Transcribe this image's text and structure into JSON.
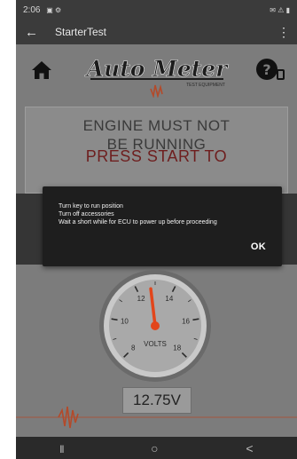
{
  "status_bar": {
    "time": "2:06",
    "left_icons": "▣ ⚙",
    "right_icons": "✉ ⚠ ▮"
  },
  "app_bar": {
    "back_icon": "←",
    "title": "StarterTest",
    "menu_icon": "⋮"
  },
  "brand": {
    "logo_text": "Auto Meter",
    "logo_subtext": "TEST EQUIPMENT"
  },
  "instructions": {
    "warning_line1": "ENGINE MUST NOT",
    "warning_line2": "BE RUNNING",
    "press_start": "PRESS START TO"
  },
  "dialog": {
    "line1": "Turn key to run position",
    "line2": "Turn off accessories",
    "line3": "Wait a short while for ECU to power up before proceeding",
    "ok_label": "OK"
  },
  "gauge": {
    "unit_label": "VOLTS",
    "tick_labels": [
      "8",
      "10",
      "12",
      "14",
      "16",
      "18"
    ],
    "needle_value_volts": 12.75,
    "needle_color": "#e2461b"
  },
  "readout": {
    "value": "12.75V"
  },
  "nav_bar": {
    "recent_icon": "|||",
    "home_icon": "○",
    "back_icon": "<"
  },
  "colors": {
    "app_bg": "#7c7c7c",
    "status_bar": "#3b3b3b",
    "dialog_bg": "#1e1e1e",
    "logo_dark": "#1d1d1d",
    "accent_red": "#b34a2a"
  }
}
